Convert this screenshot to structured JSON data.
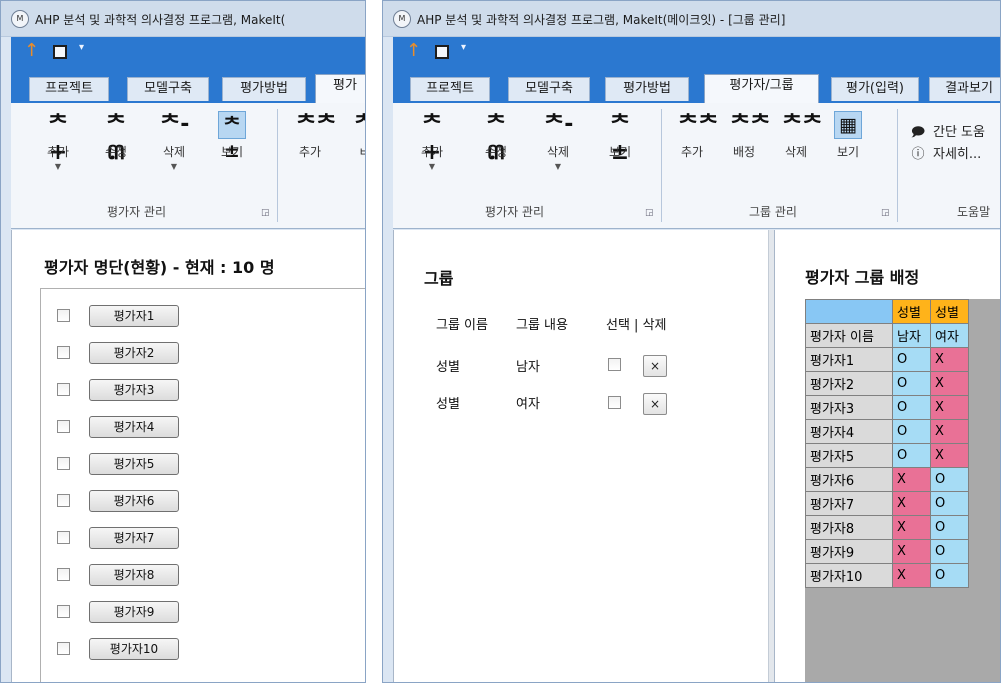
{
  "left_window": {
    "logo_text": "M",
    "title": "AHP 분석 및 과학적 의사결정 프로그램, MakeIt(",
    "tabs": [
      "프로젝트",
      "모델구축",
      "평가방법",
      "평가"
    ],
    "ribbon": {
      "evaluator_buttons": [
        {
          "label": "추가",
          "icon": "add-person-icon"
        },
        {
          "label": "수정",
          "icon": "edit-person-icon"
        },
        {
          "label": "삭제",
          "icon": "delete-person-icon"
        },
        {
          "label": "보기",
          "icon": "view-people-icon"
        }
      ],
      "group_label": "평가자 관리",
      "partial_buttons": [
        "추가",
        "ㅂ"
      ]
    },
    "heading": "평가자 명단(현황) - 현재 : 10 명",
    "evaluators": [
      "평가자1",
      "평가자2",
      "평가자3",
      "평가자4",
      "평가자5",
      "평가자6",
      "평가자7",
      "평가자8",
      "평가자9",
      "평가자10"
    ]
  },
  "right_window": {
    "logo_text": "M",
    "title": "AHP 분석 및 과학적 의사결정 프로그램, MakeIt(메이크잇) - [그룹 관리]",
    "tabs": [
      "프로젝트",
      "모델구축",
      "평가방법",
      "평가자/그룹",
      "평가(입력)",
      "결과보기"
    ],
    "active_tab": "평가자/그룹",
    "ribbon": {
      "evaluator_buttons": [
        {
          "label": "추가",
          "icon": "add-person-icon"
        },
        {
          "label": "수정",
          "icon": "edit-person-icon"
        },
        {
          "label": "삭제",
          "icon": "delete-person-icon"
        },
        {
          "label": "보기",
          "icon": "view-people-icon"
        }
      ],
      "evaluator_group_label": "평가자 관리",
      "group_buttons": [
        {
          "label": "추가",
          "icon": "add-group-icon"
        },
        {
          "label": "배정",
          "icon": "assign-group-icon"
        },
        {
          "label": "삭제",
          "icon": "delete-group-icon"
        },
        {
          "label": "보기",
          "icon": "view-group-icon"
        }
      ],
      "group_group_label": "그룹 관리",
      "help": [
        {
          "icon": "speech-bubble-icon",
          "label": "간단 도움"
        },
        {
          "icon": "info-icon",
          "label": "자세히..."
        }
      ],
      "help_group_label": "도움말"
    },
    "group_panel": {
      "heading": "그룹",
      "columns": {
        "name": "그룹 이름",
        "content": "그룹 내용",
        "select_delete": "선택 | 삭제"
      },
      "rows": [
        {
          "name": "성별",
          "content": "남자",
          "delete": "×"
        },
        {
          "name": "성별",
          "content": "여자",
          "delete": "×"
        }
      ]
    },
    "assignment": {
      "heading": "평가자 그룹 배정",
      "group_headers": [
        "성별",
        "성별"
      ],
      "row_header_label": "평가자 이름",
      "sub_headers": [
        "남자",
        "여자"
      ],
      "rows": [
        {
          "name": "평가자1",
          "values": [
            "O",
            "X"
          ]
        },
        {
          "name": "평가자2",
          "values": [
            "O",
            "X"
          ]
        },
        {
          "name": "평가자3",
          "values": [
            "O",
            "X"
          ]
        },
        {
          "name": "평가자4",
          "values": [
            "O",
            "X"
          ]
        },
        {
          "name": "평가자5",
          "values": [
            "O",
            "X"
          ]
        },
        {
          "name": "평가자6",
          "values": [
            "X",
            "O"
          ]
        },
        {
          "name": "평가자7",
          "values": [
            "X",
            "O"
          ]
        },
        {
          "name": "평가자8",
          "values": [
            "X",
            "O"
          ]
        },
        {
          "name": "평가자9",
          "values": [
            "X",
            "O"
          ]
        },
        {
          "name": "평가자10",
          "values": [
            "X",
            "O"
          ]
        }
      ]
    }
  }
}
